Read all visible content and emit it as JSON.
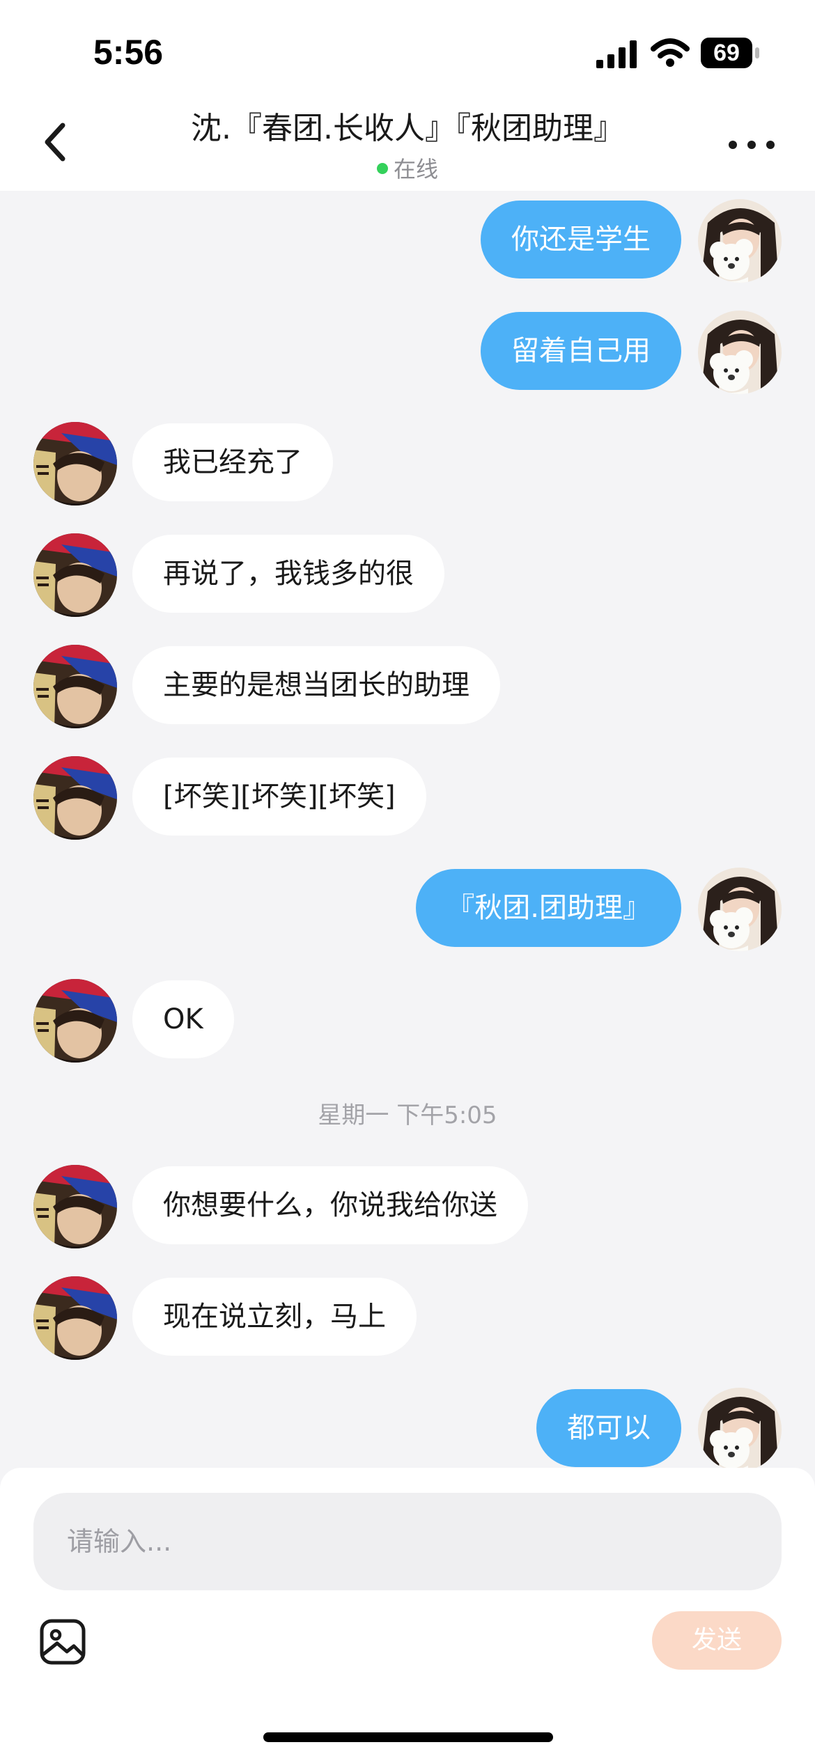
{
  "status_bar": {
    "time": "5:56",
    "battery": "69"
  },
  "header": {
    "title": "沈.『春团.长收人』『秋团助理』",
    "status": "在线"
  },
  "messages": [
    {
      "side": "right",
      "text": "你还是学生"
    },
    {
      "side": "right",
      "text": "留着自己用"
    },
    {
      "side": "left",
      "text": "我已经充了"
    },
    {
      "side": "left",
      "text": "再说了，我钱多的很"
    },
    {
      "side": "left",
      "text": "主要的是想当团长的助理"
    },
    {
      "side": "left",
      "text": "[坏笑][坏笑][坏笑]"
    },
    {
      "side": "right",
      "text": "『秋团.团助理』"
    },
    {
      "side": "left",
      "text": "OK"
    },
    {
      "side": "left",
      "text": "你想要什么，你说我给你送"
    },
    {
      "side": "left",
      "text": "现在说立刻，马上"
    },
    {
      "side": "right",
      "text": "都可以"
    }
  ],
  "timestamp": "星期一 下午5:05",
  "input": {
    "placeholder": "请输入...",
    "value": ""
  },
  "send_label": "发送",
  "colors": {
    "outgoing_bubble": "#4db1f7",
    "incoming_bubble": "#ffffff",
    "online": "#34d15b",
    "send_button": "#fbd9c7"
  }
}
